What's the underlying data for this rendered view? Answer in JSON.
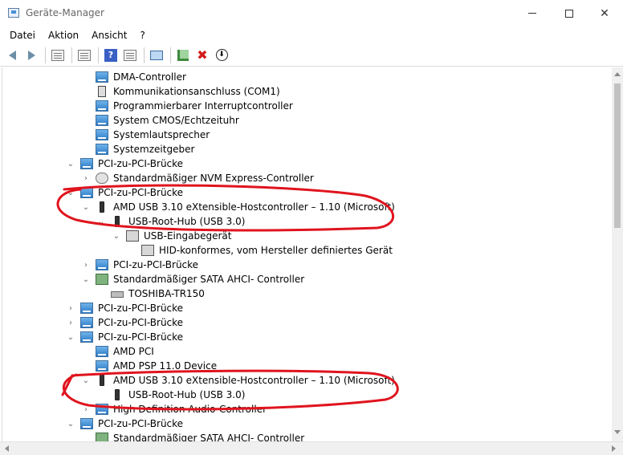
{
  "window": {
    "title": "Geräte-Manager",
    "minimize_icon": "minimize-icon",
    "maximize_icon": "maximize-icon",
    "close_glyph": "✕"
  },
  "menu": [
    "Datei",
    "Aktion",
    "Ansicht",
    "?"
  ],
  "toolbar": {
    "help_glyph": "?",
    "remove_glyph": "✖",
    "disable_glyph": "⬇"
  },
  "tree": {
    "expanded_glyph": "⌄",
    "collapsed_glyph": "›",
    "rows": [
      {
        "label": "DMA-Controller",
        "icon": "system-device-icon"
      },
      {
        "label": "Kommunikationsanschluss (COM1)",
        "icon": "com-port-icon"
      },
      {
        "label": "Programmierbarer Interruptcontroller",
        "icon": "system-device-icon"
      },
      {
        "label": "System CMOS/Echtzeituhr",
        "icon": "system-device-icon"
      },
      {
        "label": "Systemlautsprecher",
        "icon": "system-device-icon"
      },
      {
        "label": "Systemzeitgeber",
        "icon": "system-device-icon"
      },
      {
        "label": "PCI-zu-PCI-Brücke",
        "icon": "system-device-icon",
        "state": "expanded"
      },
      {
        "label": "Standardmäßiger NVM Express-Controller",
        "icon": "storage-controller-icon",
        "state": "collapsed"
      },
      {
        "label": "PCI-zu-PCI-Brücke",
        "icon": "system-device-icon",
        "state": "expanded"
      },
      {
        "label": "AMD USB 3.10 eXtensible-Hostcontroller – 1.10 (Microsoft)",
        "icon": "usb-icon",
        "state": "expanded"
      },
      {
        "label": "USB-Root-Hub (USB 3.0)",
        "icon": "usb-icon",
        "state": "expanded"
      },
      {
        "label": "USB-Eingabegerät",
        "icon": "hid-icon",
        "state": "expanded"
      },
      {
        "label": "HID-konformes, vom Hersteller definiertes Gerät",
        "icon": "hid-icon"
      },
      {
        "label": "PCI-zu-PCI-Brücke",
        "icon": "system-device-icon",
        "state": "collapsed"
      },
      {
        "label": "Standardmäßiger SATA AHCI- Controller",
        "icon": "sata-controller-icon",
        "state": "expanded"
      },
      {
        "label": "TOSHIBA-TR150",
        "icon": "disk-icon"
      },
      {
        "label": "PCI-zu-PCI-Brücke",
        "icon": "system-device-icon",
        "state": "collapsed"
      },
      {
        "label": "PCI-zu-PCI-Brücke",
        "icon": "system-device-icon",
        "state": "collapsed"
      },
      {
        "label": "PCI-zu-PCI-Brücke",
        "icon": "system-device-icon",
        "state": "expanded"
      },
      {
        "label": "AMD PCI",
        "icon": "system-device-icon"
      },
      {
        "label": "AMD PSP 11.0 Device",
        "icon": "system-device-icon"
      },
      {
        "label": "AMD USB 3.10 eXtensible-Hostcontroller – 1.10 (Microsoft)",
        "icon": "usb-icon",
        "state": "expanded"
      },
      {
        "label": "USB-Root-Hub (USB 3.0)",
        "icon": "usb-icon"
      },
      {
        "label": "High Definition Audio-Controller",
        "icon": "system-device-icon",
        "state": "collapsed"
      },
      {
        "label": "PCI-zu-PCI-Brücke",
        "icon": "system-device-icon",
        "state": "expanded"
      },
      {
        "label": "Standardmäßiger SATA AHCI- Controller",
        "icon": "sata-controller-icon"
      }
    ]
  },
  "annotation": {
    "color": "#e0141e"
  }
}
